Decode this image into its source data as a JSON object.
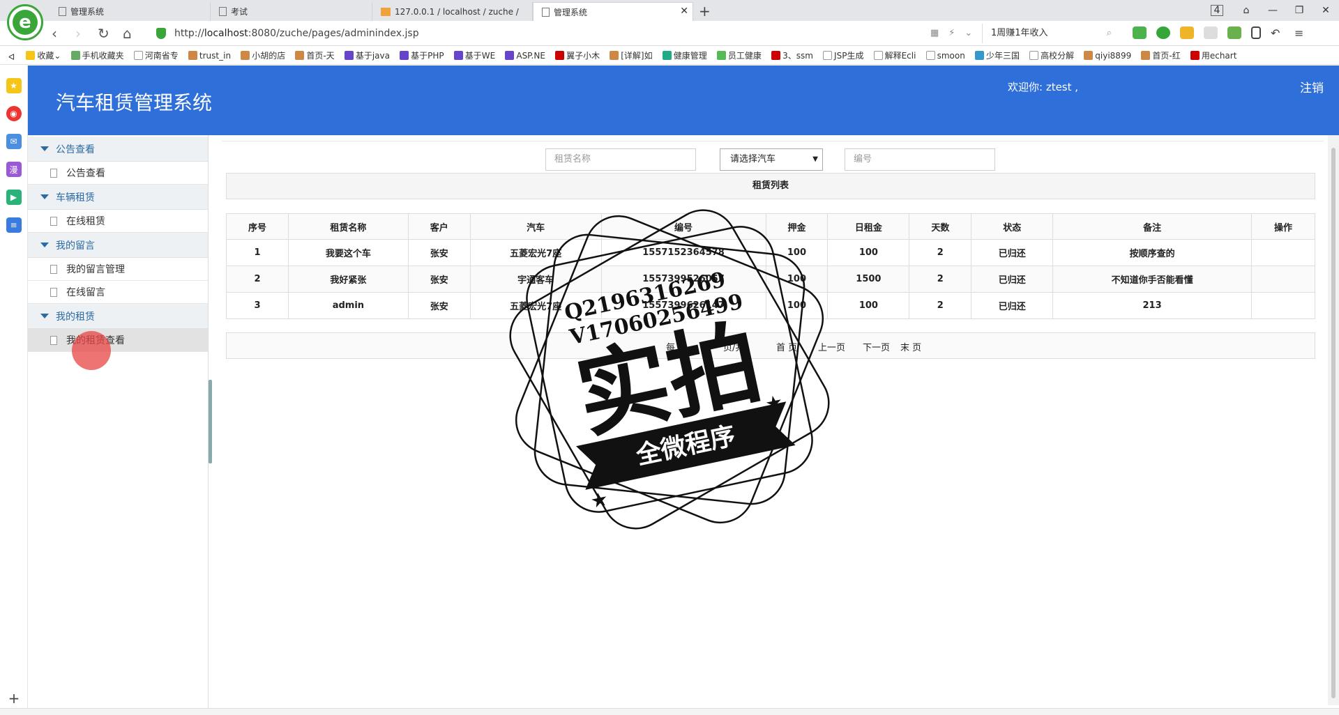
{
  "browser": {
    "tabs": [
      {
        "title": "管理系统"
      },
      {
        "title": "考试"
      },
      {
        "title": "127.0.0.1 / localhost / zuche /"
      },
      {
        "title": "管理系统",
        "active": true
      }
    ],
    "tab_count": "4",
    "url_prefix": "http://",
    "url_host": "localhost",
    "url_path": ":8080/zuche/pages/adminindex.jsp",
    "search_text": "1周赚1年收入",
    "bookmarks": [
      "收藏",
      "手机收藏夹",
      "河南省专",
      "trust_in",
      "小胡的店",
      "首页-天",
      "基于java",
      "基于PHP",
      "基于WE",
      "ASP.NE",
      "翼子小木",
      "[详解]如",
      "健康管理",
      "员工健康",
      "3、ssm",
      "JSP生成",
      "解释Ecli",
      "smoon",
      "少年三国",
      "高校分解",
      "qiyi8899",
      "首页-红",
      "用echart"
    ]
  },
  "app": {
    "title": "汽车租赁管理系统",
    "welcome": "欢迎你: ztest ,",
    "logout": "注销"
  },
  "sidebar": {
    "groups": [
      {
        "label": "公告查看",
        "items": [
          "公告查看"
        ]
      },
      {
        "label": "车辆租赁",
        "items": [
          "在线租赁"
        ]
      },
      {
        "label": "我的留言",
        "items": [
          "我的留言管理",
          "在线留言"
        ]
      },
      {
        "label": "我的租赁",
        "items": [
          "我的租赁查看"
        ]
      }
    ]
  },
  "filters": {
    "name_placeholder": "租赁名称",
    "car_select": "请选择汽车",
    "code_placeholder": "编号"
  },
  "list_title": "租赁列表",
  "table": {
    "headers": [
      "序号",
      "租赁名称",
      "客户",
      "汽车",
      "编号",
      "押金",
      "日租金",
      "天数",
      "状态",
      "备注",
      "操作"
    ],
    "rows": [
      [
        "1",
        "我要这个车",
        "张安",
        "五菱宏光7座",
        "1557152364578",
        "100",
        "100",
        "2",
        "已归还",
        "按顺序查的",
        ""
      ],
      [
        "2",
        "我好紧张",
        "张安",
        "宇通客车",
        "1557399526057",
        "100",
        "1500",
        "2",
        "已归还",
        "不知道你手否能看懂",
        ""
      ],
      [
        "3",
        "admin",
        "张安",
        "五菱宏光7座",
        "1557399626147",
        "100",
        "100",
        "2",
        "已归还",
        "213",
        ""
      ]
    ]
  },
  "pager": {
    "info_left": "每",
    "info_mid": "页/共",
    "first": "首 页",
    "prev": "上一页",
    "next": "下一页",
    "last": "末 页"
  },
  "watermark": {
    "line1": "Q2196316269",
    "line2": "V17060256499",
    "big": "实拍",
    "banner": "全微程序"
  },
  "colors": {
    "header_blue": "#2f6fd9",
    "sidebar_link": "#2a6aa5",
    "cursor_highlight": "#e84646"
  }
}
